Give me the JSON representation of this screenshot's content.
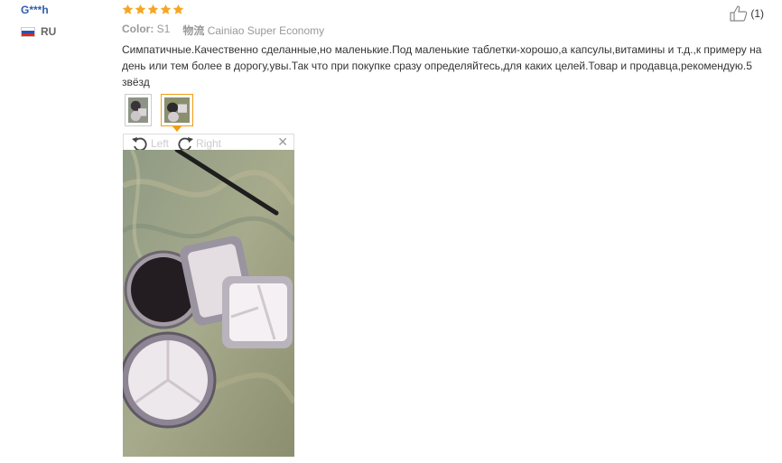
{
  "user": {
    "name": "G***h",
    "country_code": "RU"
  },
  "rating": {
    "stars": 5,
    "max": 5,
    "color": "#f5a623"
  },
  "meta": {
    "color_label": "Color:",
    "color_value": "S1",
    "logistics_label": "物流",
    "logistics_value": "Cainiao Super Economy"
  },
  "helpful": {
    "icon": "thumbs-up-icon",
    "count": "(1)"
  },
  "review": {
    "text": "Симпатичные.Качественно сделанные,но маленькие.Под маленькие таблетки-хорошо,а капсулы,витамины и т.д.,к примеру на день или тем более в дорогу,увы.Так что при покупке сразу определяйтесь,для каких целей.Товар и продавца,рекомендую.5 звёзд"
  },
  "viewer": {
    "rotate_left_label": "Left",
    "rotate_right_label": "Right",
    "close_icon": "close-icon",
    "accent_color": "#f39c12"
  }
}
